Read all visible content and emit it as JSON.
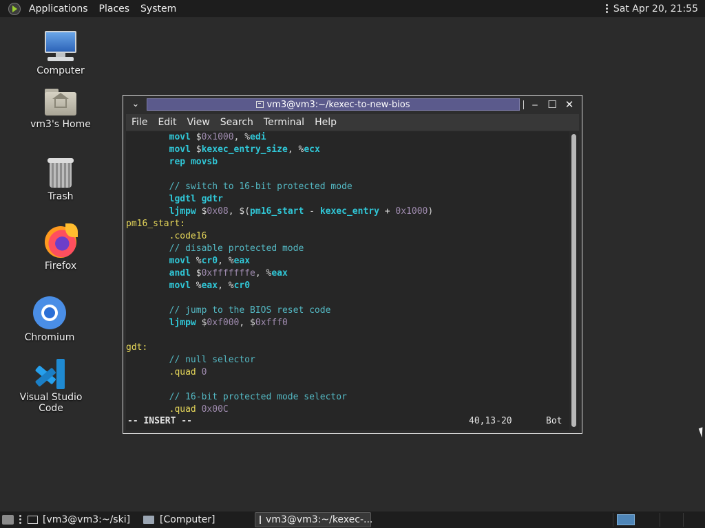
{
  "top_panel": {
    "menus": [
      "Applications",
      "Places",
      "System"
    ],
    "clock": "Sat Apr 20, 21:55"
  },
  "desktop_icons": [
    {
      "label": "Computer",
      "icon": "computer-icon"
    },
    {
      "label": "vm3's Home",
      "icon": "home-folder-icon"
    },
    {
      "label": "Trash",
      "icon": "trash-icon"
    },
    {
      "label": "Firefox",
      "icon": "firefox-icon"
    },
    {
      "label": "Chromium",
      "icon": "chromium-icon"
    },
    {
      "label": "Visual Studio Code",
      "icon": "vscode-icon"
    }
  ],
  "terminal": {
    "title": "vm3@vm3:~/kexec-to-new-bios",
    "menus": [
      "File",
      "Edit",
      "View",
      "Search",
      "Terminal",
      "Help"
    ],
    "lines": [
      "        movl $0x1000, %edi",
      "        movl $kexec_entry_size, %ecx",
      "        rep movsb",
      "",
      "        // switch to 16-bit protected mode",
      "        lgdtl gdtr",
      "        ljmpw $0x08, $(pm16_start - kexec_entry + 0x1000)",
      "pm16_start:",
      "        .code16",
      "        // disable protected mode",
      "        movl %cr0, %eax",
      "        andl $0xfffffffe, %eax",
      "        movl %eax, %cr0",
      "",
      "        // jump to the BIOS reset code",
      "        ljmpw $0xf000, $0xfff0",
      "",
      "gdt:",
      "        // null selector",
      "        .quad 0",
      "",
      "        // 16-bit protected mode selector",
      "        .quad 0x00C"
    ],
    "status": {
      "mode": "-- INSERT --",
      "position": "40,13-20",
      "scroll": "Bot"
    }
  },
  "taskbar": {
    "tasks": [
      {
        "label": "[vm3@vm3:~/ski]",
        "active": false
      },
      {
        "label": "[Computer]",
        "active": false
      },
      {
        "label": "vm3@vm3:~/kexec-...",
        "active": true
      }
    ]
  },
  "colors": {
    "desktop_bg": "#2b2b2b",
    "panel_bg": "#1d1d1d",
    "title_bar": "#5b5a8c",
    "keyword": "#30c7d7",
    "number": "#a08cb0",
    "comment": "#54b9c4",
    "label": "#e6d75a"
  }
}
